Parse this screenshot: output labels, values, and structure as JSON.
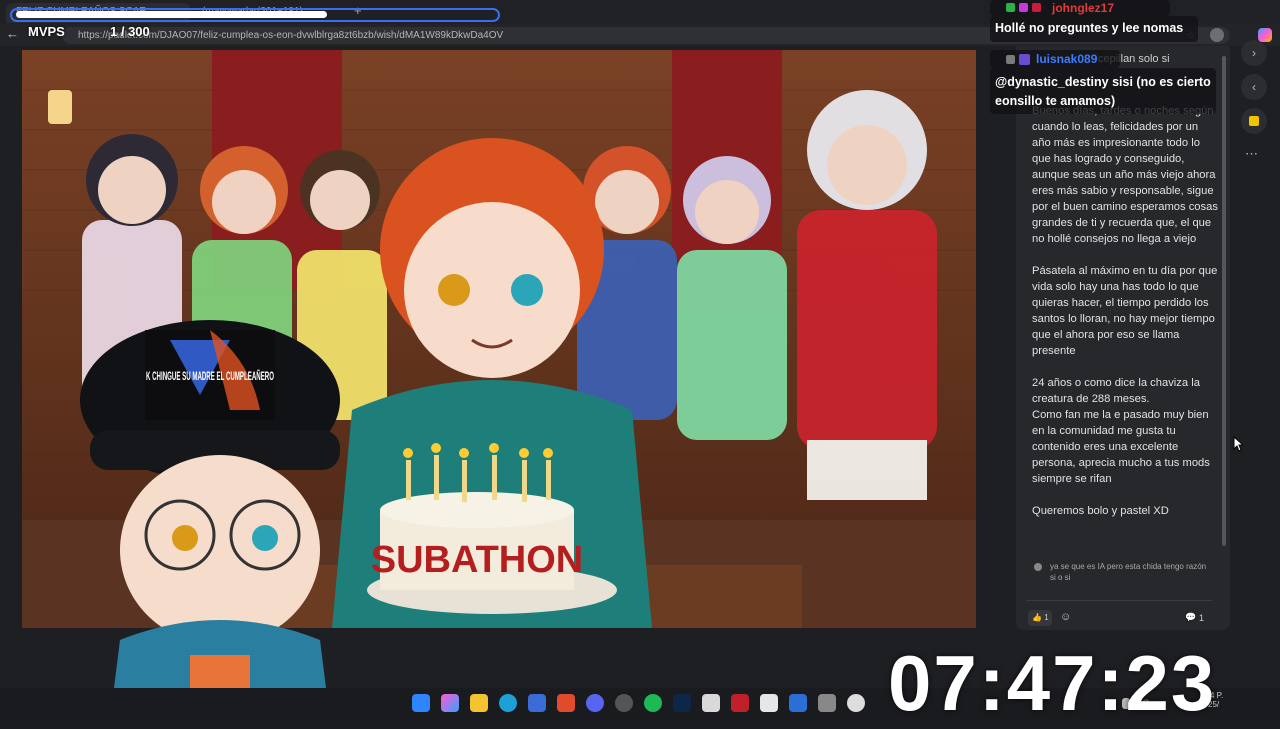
{
  "browser": {
    "tabs": [
      {
        "label": "FELIZ CUMPLEAÑOS SCAR"
      },
      {
        "label": "(mayowadar(201+181)"
      }
    ],
    "add_tab": "+",
    "url": "https://padlet.com/DJAO07/feliz-cumplea-os-eon-dvwlblrga8zt6bzb/wish/dMA1W89kDkwDa4OV"
  },
  "stream_overlay": {
    "goal_label": "MVPS",
    "goal_count": "1 / 300",
    "goal_progress": 0.65,
    "timer": "07:47:23",
    "cap_text": "K CHINGUE SU MADRE EL CUMPLEAÑERO"
  },
  "artwork": {
    "cake_text": "SUBATHON"
  },
  "chat": [
    {
      "user": "johnglez17",
      "message": "Hollé no preguntes y lee nomas",
      "user_color": "#e23a3a"
    },
    {
      "user": "luisnak089",
      "message": "@dynastic_destiny sisi (no es cierto eonsillo te amamos)",
      "user_color": "#3c7cff"
    }
  ],
  "card": {
    "snippet": "cepillan solo si",
    "body": "Buenos días, tardes o noches según cuando lo leas, felicidades por un año más es impresionante todo lo que has logrado y conseguido, aunque seas un año más viejo ahora eres  más sabio y responsable, sigue por el buen camino esperamos cosas grandes de ti  y recuerda que, el que no hollé consejos no llega a viejo\n\nPásatela al máximo en tu día por que vida solo hay una has todo lo que quieras hacer, el tiempo perdido los santos lo lloran, no hay mejor tiempo que el ahora por eso se llama presente\n\n24 años o como dice la chaviza la creatura de 288 meses.\nComo fan me la e pasado muy bien en la comunidad  me gusta tu contenido eres una excelente persona, aprecia mucho a tus mods siempre se rifan\n\nQueremos bolo y pastel XD",
    "comment": "ya se que es IA pero esta chida tengo razón si o si",
    "like_count": "1",
    "comment_count": "1"
  },
  "taskbar": {
    "tray_text": "NG",
    "time": "4 P.",
    "date": "25/"
  },
  "colors": {
    "accent": "#3a6df0",
    "chat_user1": "#e23a3a",
    "chat_user2": "#3c7cff",
    "note_icon": "#f2c400"
  }
}
